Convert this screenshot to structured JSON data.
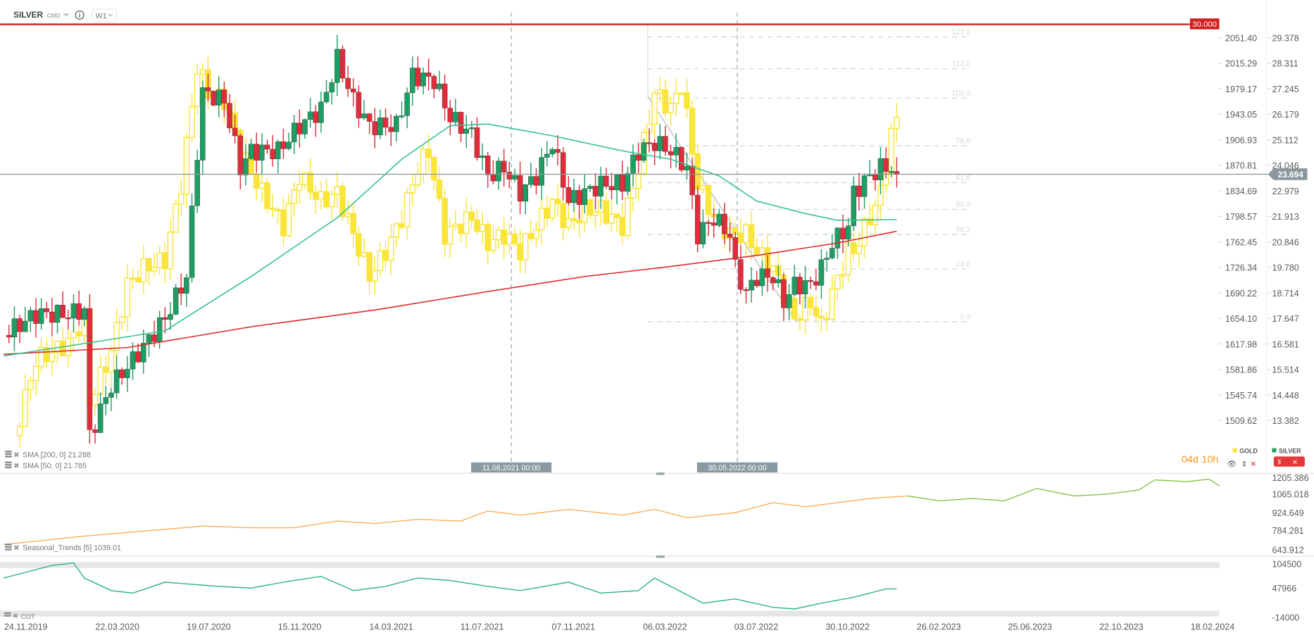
{
  "header": {
    "symbol": "SILVER",
    "type": "CMD",
    "interval": "W1"
  },
  "colors": {
    "gold_up_stroke": "#f8e43c",
    "gold_fill": "#fbe53b",
    "silver_up": "#1e9e62",
    "silver_down": "#e12c3b",
    "sma200": "#e0242c",
    "sma50": "#32c08c",
    "seasonal_hist": "#fdb05c",
    "seasonal_fcst": "#8cc04a",
    "cot": "#2db67c",
    "level_line": "#d21f1f",
    "price_tag": "#8a969c"
  },
  "levels": {
    "alert_line": "30.000",
    "current_price": "23.694"
  },
  "indicators": {
    "sma200": "SMA [200, 0] 21.288",
    "sma50": "SMA [50, 0] 21.785",
    "seasonal": "Seasonal_Trends [5] 1039.01",
    "cot": "COT"
  },
  "vlines": [
    {
      "label": "11.08.2021 00:00",
      "week": 86
    },
    {
      "label": "30.05.2022 00:00",
      "week": 128
    }
  ],
  "legend": {
    "gold": "GOLD",
    "silver": "SILVER",
    "countdown_days": "04d",
    "countdown_hours": "10h"
  },
  "fib_levels": [
    "127.2",
    "113.0",
    "100.0",
    "78.6",
    "61.8",
    "50.0",
    "38.2",
    "23.6",
    "0.0"
  ],
  "chart_data": [
    {
      "type": "candlestick",
      "title": "SILVER vs GOLD W1",
      "x_unit": "weeks since 24.11.2019",
      "x_tick_labels": [
        "24.11.2019",
        "22.03.2020",
        "19.07.2020",
        "15.11.2020",
        "14.03.2021",
        "11.07.2021",
        "07.11.2021",
        "06.03.2022",
        "03.07.2022",
        "30.10.2022",
        "26.02.2023",
        "25.06.2023",
        "22.10.2023",
        "18.02.2024"
      ],
      "gold_axis_ticks": [
        "2051.40",
        "2015.29",
        "1979.17",
        "1943.05",
        "1906.93",
        "1870.81",
        "1834.69",
        "1798.57",
        "1762.45",
        "1726.34",
        "1690.22",
        "1654.10",
        "1617.98",
        "1581.86",
        "1545.74",
        "1509.62"
      ],
      "silver_axis_ticks": [
        "29.378",
        "28.311",
        "27.245",
        "26.179",
        "25.112",
        "24.046",
        "22.979",
        "21.913",
        "20.846",
        "19.780",
        "18.714",
        "17.647",
        "16.581",
        "15.514",
        "14.448",
        "13.382"
      ],
      "gold_ylim": [
        1509.62,
        2051.4
      ],
      "silver_ylim": [
        13.382,
        29.378
      ],
      "gold_close": [
        [
          -2,
          1488
        ],
        [
          2,
          1595
        ],
        [
          8,
          1619
        ],
        [
          11,
          1654
        ],
        [
          12,
          1536
        ],
        [
          16,
          1607
        ],
        [
          19,
          1702
        ],
        [
          22,
          1725
        ],
        [
          26,
          1737
        ],
        [
          29,
          1844
        ],
        [
          32,
          2010
        ],
        [
          34,
          1974
        ],
        [
          37,
          1963
        ],
        [
          40,
          1891
        ],
        [
          44,
          1832
        ],
        [
          48,
          1785
        ],
        [
          51,
          1856
        ],
        [
          55,
          1820
        ],
        [
          58,
          1832
        ],
        [
          61,
          1773
        ],
        [
          64,
          1714
        ],
        [
          67,
          1749
        ],
        [
          70,
          1797
        ],
        [
          73,
          1868
        ],
        [
          75,
          1891
        ],
        [
          78,
          1773
        ],
        [
          83,
          1797
        ],
        [
          86,
          1761
        ],
        [
          89,
          1773
        ],
        [
          92,
          1749
        ],
        [
          95,
          1785
        ],
        [
          98,
          1820
        ],
        [
          101,
          1785
        ],
        [
          104,
          1808
        ],
        [
          107,
          1808
        ],
        [
          111,
          1785
        ],
        [
          114,
          1868
        ],
        [
          117,
          1974
        ],
        [
          120,
          1951
        ],
        [
          122,
          1986
        ],
        [
          125,
          1844
        ],
        [
          128,
          1797
        ],
        [
          131,
          1773
        ],
        [
          134,
          1773
        ],
        [
          136,
          1749
        ],
        [
          139,
          1725
        ],
        [
          141,
          1690
        ],
        [
          143,
          1654
        ],
        [
          146,
          1678
        ],
        [
          148,
          1642
        ],
        [
          150,
          1690
        ],
        [
          153,
          1749
        ],
        [
          154,
          1749
        ],
        [
          157,
          1797
        ],
        [
          159,
          1832
        ],
        [
          161,
          1915
        ],
        [
          162,
          1939
        ]
      ],
      "silver_close": [
        [
          -4,
          16.95
        ],
        [
          2,
          17.83
        ],
        [
          8,
          17.83
        ],
        [
          11,
          18.0
        ],
        [
          12,
          12.75
        ],
        [
          16,
          14.85
        ],
        [
          20,
          15.9
        ],
        [
          26,
          17.65
        ],
        [
          30,
          19.4
        ],
        [
          32,
          24.65
        ],
        [
          33,
          27.1
        ],
        [
          37,
          26.75
        ],
        [
          40,
          23.95
        ],
        [
          42,
          24.65
        ],
        [
          47,
          24.65
        ],
        [
          51,
          25.7
        ],
        [
          55,
          26.4
        ],
        [
          58,
          28.5
        ],
        [
          61,
          26.75
        ],
        [
          64,
          25.7
        ],
        [
          69,
          25.7
        ],
        [
          72,
          27.8
        ],
        [
          76,
          27.6
        ],
        [
          79,
          26.05
        ],
        [
          83,
          25.35
        ],
        [
          86,
          23.6
        ],
        [
          89,
          23.95
        ],
        [
          92,
          22.9
        ],
        [
          95,
          23.6
        ],
        [
          98,
          25.0
        ],
        [
          101,
          22.55
        ],
        [
          104,
          22.9
        ],
        [
          107,
          23.25
        ],
        [
          111,
          23.25
        ],
        [
          114,
          24.65
        ],
        [
          117,
          25.0
        ],
        [
          120,
          24.65
        ],
        [
          123,
          23.95
        ],
        [
          125,
          21.15
        ],
        [
          128,
          21.85
        ],
        [
          131,
          21.15
        ],
        [
          132,
          19.75
        ],
        [
          134,
          18.7
        ],
        [
          136,
          19.4
        ],
        [
          139,
          19.4
        ],
        [
          141,
          18.35
        ],
        [
          143,
          19.05
        ],
        [
          146,
          19.05
        ],
        [
          148,
          19.75
        ],
        [
          150,
          20.8
        ],
        [
          153,
          21.5
        ],
        [
          154,
          22.9
        ],
        [
          157,
          23.6
        ],
        [
          159,
          23.95
        ],
        [
          161,
          23.95
        ],
        [
          162,
          23.69
        ]
      ],
      "sma200": [
        [
          -4,
          16.15
        ],
        [
          19,
          16.43
        ],
        [
          42,
          17.3
        ],
        [
          65,
          18.0
        ],
        [
          86,
          18.77
        ],
        [
          104,
          19.4
        ],
        [
          120,
          19.82
        ],
        [
          136,
          20.28
        ],
        [
          151,
          20.8
        ],
        [
          162,
          21.29
        ]
      ],
      "sma50": [
        [
          -4,
          16.08
        ],
        [
          11,
          16.6
        ],
        [
          26,
          17.13
        ],
        [
          42,
          19.4
        ],
        [
          58,
          21.85
        ],
        [
          70,
          24.3
        ],
        [
          79,
          25.7
        ],
        [
          86,
          25.77
        ],
        [
          98,
          25.28
        ],
        [
          111,
          24.65
        ],
        [
          120,
          24.3
        ],
        [
          129,
          23.6
        ],
        [
          136,
          22.55
        ],
        [
          145,
          22.03
        ],
        [
          151,
          21.75
        ],
        [
          162,
          21.78
        ]
      ]
    },
    {
      "type": "line",
      "title": "Seasonal_Trends [5]",
      "y_ticks": [
        "1205.386",
        "1065.018",
        "924.649",
        "784.281",
        "643.912"
      ],
      "ylim": [
        643.912,
        1205.386
      ],
      "history_end_week": 164,
      "values": [
        [
          -4,
          706
        ],
        [
          11,
          769
        ],
        [
          26,
          819
        ],
        [
          33,
          844
        ],
        [
          42,
          831
        ],
        [
          50,
          831
        ],
        [
          58,
          881
        ],
        [
          65,
          862
        ],
        [
          73,
          894
        ],
        [
          81,
          881
        ],
        [
          86,
          956
        ],
        [
          92,
          925
        ],
        [
          101,
          968
        ],
        [
          111,
          925
        ],
        [
          117,
          968
        ],
        [
          123,
          906
        ],
        [
          132,
          943
        ],
        [
          139,
          1018
        ],
        [
          145,
          987
        ],
        [
          151,
          1018
        ],
        [
          157,
          1049
        ],
        [
          164,
          1068
        ],
        [
          170,
          1031
        ],
        [
          176,
          1049
        ],
        [
          182,
          1031
        ],
        [
          188,
          1124
        ],
        [
          195,
          1068
        ],
        [
          201,
          1081
        ],
        [
          207,
          1112
        ],
        [
          210,
          1187
        ],
        [
          216,
          1174
        ],
        [
          220,
          1193
        ],
        [
          222,
          1143
        ]
      ]
    },
    {
      "type": "line",
      "title": "COT",
      "y_ticks": [
        "104500",
        "47966",
        "-14000"
      ],
      "ylim": [
        -14000,
        104500
      ],
      "values": [
        [
          -4,
          71686
        ],
        [
          2,
          89916
        ],
        [
          5,
          99031
        ],
        [
          9,
          104500
        ],
        [
          11,
          71686
        ],
        [
          16,
          44341
        ],
        [
          20,
          38872
        ],
        [
          26,
          62571
        ],
        [
          36,
          53456
        ],
        [
          42,
          49810
        ],
        [
          48,
          62571
        ],
        [
          55,
          75332
        ],
        [
          61,
          44341
        ],
        [
          67,
          53456
        ],
        [
          73,
          71686
        ],
        [
          79,
          66217
        ],
        [
          86,
          53456
        ],
        [
          92,
          44341
        ],
        [
          101,
          62571
        ],
        [
          107,
          38872
        ],
        [
          114,
          44341
        ],
        [
          117,
          71686
        ],
        [
          120,
          53456
        ],
        [
          126,
          16996
        ],
        [
          132,
          26111
        ],
        [
          139,
          7881
        ],
        [
          143,
          4235
        ],
        [
          148,
          16996
        ],
        [
          154,
          29757
        ],
        [
          160,
          47987
        ],
        [
          162,
          47987
        ]
      ]
    }
  ]
}
